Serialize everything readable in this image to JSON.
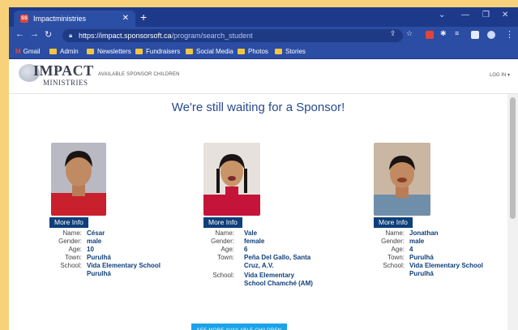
{
  "browser": {
    "tab_title": "Impactministries",
    "tab_favicon_text": "SS",
    "new_tab": "+",
    "url_host": "https://impact.sponsorsoft.ca",
    "url_path": "/program/search_student",
    "bookmarks": [
      {
        "label": "Gmail",
        "icon": "gmail-icon"
      },
      {
        "label": "Admin",
        "icon": "folder-icon"
      },
      {
        "label": "Newsletters",
        "icon": "folder-icon"
      },
      {
        "label": "Fundraisers",
        "icon": "folder-icon"
      },
      {
        "label": "Social Media",
        "icon": "folder-icon"
      },
      {
        "label": "Photos",
        "icon": "folder-icon"
      },
      {
        "label": "Stories",
        "icon": "folder-icon"
      }
    ]
  },
  "site": {
    "logo_word1": "IMPACT",
    "logo_word2": "MINISTRIES",
    "nav_link": "AVAILABLE SPONSOR CHILDREN",
    "login": "LOG IN ▾",
    "heading": "We're still waiting for a Sponsor!",
    "more_info_label": "More Info",
    "see_more_label": "SEE MORE AVAILABLE CHILDREN",
    "field_labels": {
      "name": "Name:",
      "gender": "Gender:",
      "age": "Age:",
      "town": "Town:",
      "school": "School:"
    }
  },
  "children": [
    {
      "name": "César",
      "gender": "male",
      "age": "10",
      "town": "Purulhá",
      "school": "Vida Elementary School Purulhá"
    },
    {
      "name": "Vale",
      "gender": "female",
      "age": "6",
      "town": "Peña Del Gallo, Santa Cruz, A.V.",
      "school": "Vida Elementary School Chamché (AM)"
    },
    {
      "name": "Jonathan",
      "gender": "male",
      "age": "4",
      "town": "Purulhá",
      "school": "Vida Elementary School Purulhá"
    }
  ],
  "colors": {
    "accent": "#0e3f7a",
    "heading": "#274a8f",
    "see_more_button": "#1aa3e8",
    "browser_chrome": "#2b4da3"
  }
}
